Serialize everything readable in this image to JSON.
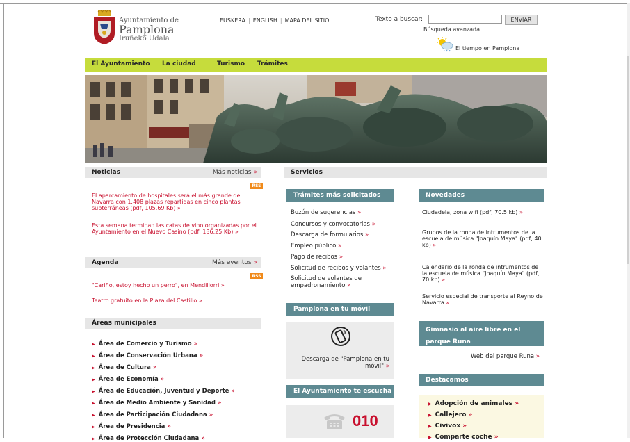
{
  "header": {
    "logo_line1": "Ayuntamiento de",
    "logo_line2": "Pamplona",
    "logo_line3": "Iruñeko Udala",
    "languages": [
      "EUSKERA",
      "ENGLISH",
      "MAPA DEL SITIO"
    ],
    "search_label": "Texto a buscar:",
    "search_value": "",
    "search_button": "ENVIAR",
    "advanced_search": "Búsqueda avanzada",
    "weather_link": "El tiempo en Pamplona"
  },
  "nav": {
    "items": [
      "El Ayuntamiento",
      "La ciudad",
      "Turismo",
      "Trámites"
    ]
  },
  "noticias": {
    "title": "Noticias",
    "more": "Más noticias",
    "rss": "RSS",
    "items": [
      "El aparcamiento de hospitales será el más grande de Navarra con 1.408 plazas repartidas en cinco plantas subterráneas (pdf, 105.69 Kb)",
      "Esta semana terminan las catas de vino organizadas por el Ayuntamiento en el Nuevo Casino (pdf, 136.25 Kb)"
    ]
  },
  "agenda": {
    "title": "Agenda",
    "more": "Más eventos",
    "rss": "RSS",
    "items": [
      "\"Cariño, estoy hecho un perro\", en Mendillorri",
      "Teatro gratuito en la Plaza del Castillo"
    ]
  },
  "areas": {
    "title": "Áreas municipales",
    "items": [
      "Área de Comercio y Turismo",
      "Área de Conservación Urbana",
      "Área de Cultura",
      "Área de Economía",
      "Área de Educación, Juventud y Deporte",
      "Área de Medio Ambiente y Sanidad",
      "Área de Participación Ciudadana",
      "Área de Presidencia",
      "Área de Protección Ciudadana"
    ]
  },
  "servicios": {
    "title": "Servicios",
    "tramites_title": "Trámites más solicitados",
    "tramites": [
      "Buzón de sugerencias",
      "Concursos y convocatorias",
      "Descarga de formularios",
      "Empleo público",
      "Pago de recibos",
      "Solicitud de recibos y volantes",
      "Solicitud de volantes de empadronamiento"
    ],
    "movil_title": "Pamplona en tu móvil",
    "movil_link": "Descarga de \"Pamplona en tu móvil\"",
    "escucha_title": "El Ayuntamiento te escucha",
    "phone_number": "010"
  },
  "novedades": {
    "title": "Novedades",
    "items": [
      "Ciudadela, zona wifi (pdf, 70.5 kb)",
      "Grupos de la ronda de intrumentos de la escuela de música \"Joaquín Maya\" (pdf, 40 kb)",
      "Calendario de la ronda de intrumentos de la escuela de música \"Joaquín Maya\" (pdf, 70 kb)",
      "Servicio especial de transporte al Reyno de Navarra"
    ],
    "gym_title": "Gimnasio al aire libre en el parque Runa",
    "gym_link": "Web del parque Runa",
    "destacamos_title": "Destacamos",
    "destacamos": [
      "Adopción de animales",
      "Callejero",
      "Civivox",
      "Comparte coche"
    ]
  },
  "colors": {
    "nav_bg": "#c6dc3c",
    "section_header_bg": "#5e8a92",
    "link_red": "#c8102e"
  }
}
